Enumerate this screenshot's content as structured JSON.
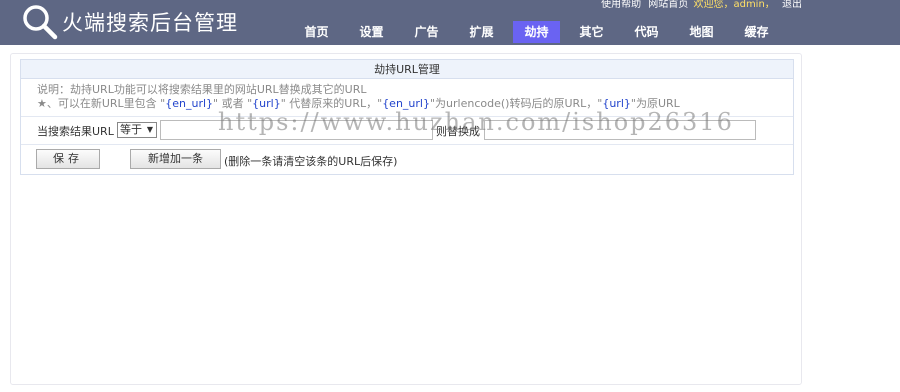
{
  "header": {
    "title": "火端搜索后台管理",
    "top_links": {
      "help": "使用帮助",
      "site_home": "网站首页",
      "welcome": "欢迎您，",
      "user": "admin，",
      "logout": "退出"
    }
  },
  "nav": {
    "items": [
      {
        "label": "首页"
      },
      {
        "label": "设置"
      },
      {
        "label": "广告"
      },
      {
        "label": "扩展"
      },
      {
        "label": "劫持"
      },
      {
        "label": "其它"
      },
      {
        "label": "代码"
      },
      {
        "label": "地图"
      },
      {
        "label": "缓存"
      }
    ],
    "active": "劫持"
  },
  "panel": {
    "title": "劫持URL管理",
    "desc_line1": "说明：劫持URL功能可以将搜索结果里的网站URL替换成其它的URL",
    "desc_line2_prefix": "★、可以在新URL里包含 \"",
    "desc_token1": "{en_url}",
    "desc_mid1": "\" 或者 \"",
    "desc_token2": "{url}",
    "desc_mid2": "\" 代替原来的URL，\"",
    "desc_token3": "{en_url}",
    "desc_mid3": "\"为urlencode()转码后的原URL，\"",
    "desc_token4": "{url}",
    "desc_suffix": "\"为原URL",
    "rule": {
      "label": "当搜索结果URL",
      "select_value": "等于",
      "input1_value": "",
      "label2": "则替换成",
      "input2_value": ""
    },
    "buttons": {
      "save": "保存",
      "add": "新增加一条",
      "note": "(删除一条请清空该条的URL后保存)"
    }
  },
  "watermark": "https://www.huzhan.com/ishop26316",
  "colors": {
    "header_bg": "#5e6784",
    "nav_active": "#6a63f2",
    "highlight": "#2244cc"
  }
}
